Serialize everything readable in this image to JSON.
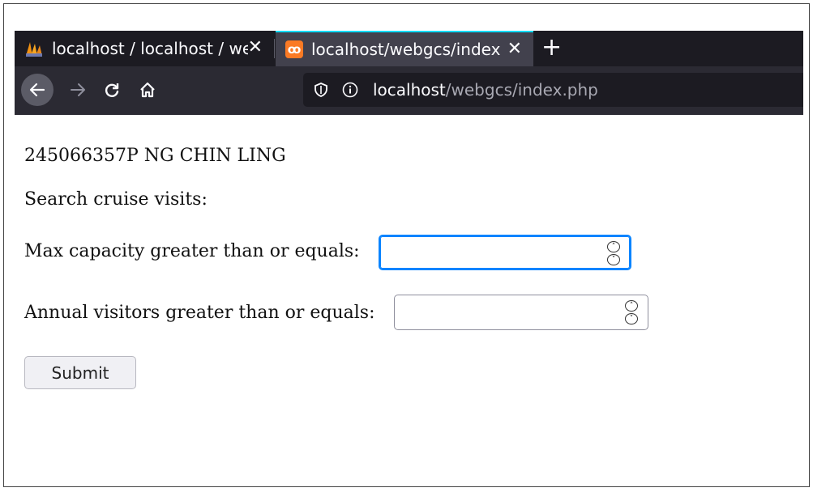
{
  "browser": {
    "tabs": [
      {
        "title": "localhost / localhost / webgcs | phpMyAdmin",
        "icon": "phpmyadmin-icon",
        "active": false
      },
      {
        "title": "localhost/webgcs/index.php",
        "icon": "xampp-icon",
        "active": true
      }
    ],
    "new_tab_label": "+",
    "url": {
      "host": "localhost",
      "path": "/webgcs/index.php"
    }
  },
  "page": {
    "student_line": "245066357P NG CHIN LING",
    "search_heading": "Search cruise visits:",
    "fields": {
      "max_capacity": {
        "label": "Max capacity greater than or equals:",
        "value": ""
      },
      "annual_visitors": {
        "label": "Annual visitors greater than or equals:",
        "value": ""
      }
    },
    "submit_label": "Submit"
  },
  "colors": {
    "active_tab_accent": "#00ddff",
    "focus_ring": "#0a84ff",
    "xampp_orange": "#fb7a24"
  }
}
